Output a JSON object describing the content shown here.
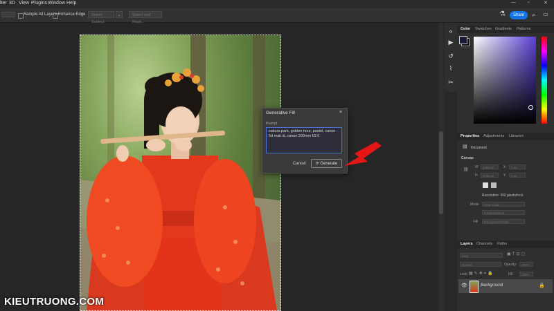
{
  "menubar": {
    "items": [
      "lter",
      "3D",
      "View",
      "Plugins",
      "Window",
      "Help"
    ]
  },
  "optionsbar": {
    "sample_all_layers": "Sample All Layers",
    "enhance_edge": "Enhance Edge",
    "select_subject": "Select Subject",
    "select_and_mask": "Select and Mask...",
    "share": "Share"
  },
  "dialog": {
    "title": "Generative Fill",
    "close": "×",
    "prompt_label": "Prompt",
    "prompt_text": "sakura park, golden hour, pastel, canon 5d mak iii, canon 200mm f/2.0",
    "cancel": "Cancel",
    "generate": "Generate"
  },
  "color_panel": {
    "tabs": [
      "Color",
      "Swatches",
      "Gradients",
      "Patterns"
    ],
    "foreground": "#1a1a3a",
    "background": "#000000",
    "hue": "#5b3fd6"
  },
  "properties_panel": {
    "tabs": [
      "Properties",
      "Adjustments",
      "Libraries"
    ],
    "document_label": "Document",
    "canvas_label": "Canvas",
    "w_label": "W",
    "h_label": "H",
    "x_label": "X",
    "y_label": "Y",
    "w_value": "4480 px",
    "h_value": "6720 px",
    "x_value": "0 px",
    "y_value": "0 px",
    "resolution": "Resolution: 300 pixels/inch",
    "mode_label": "Mode",
    "mode_value": "RGB Color",
    "bit_value": "8 Bits/Channel",
    "fill_label": "Fill",
    "fill_value": "Background Color"
  },
  "layers_panel": {
    "tabs": [
      "Layers",
      "Channels",
      "Paths"
    ],
    "search_placeholder": "Kind",
    "blend_mode": "Normal",
    "opacity_label": "Opacity:",
    "opacity_value": "100%",
    "lock_label": "Lock:",
    "fill_label": "Fill:",
    "fill_value": "100%",
    "layer_name": "Background"
  },
  "watermark": "KIEUTRUONG.COM"
}
